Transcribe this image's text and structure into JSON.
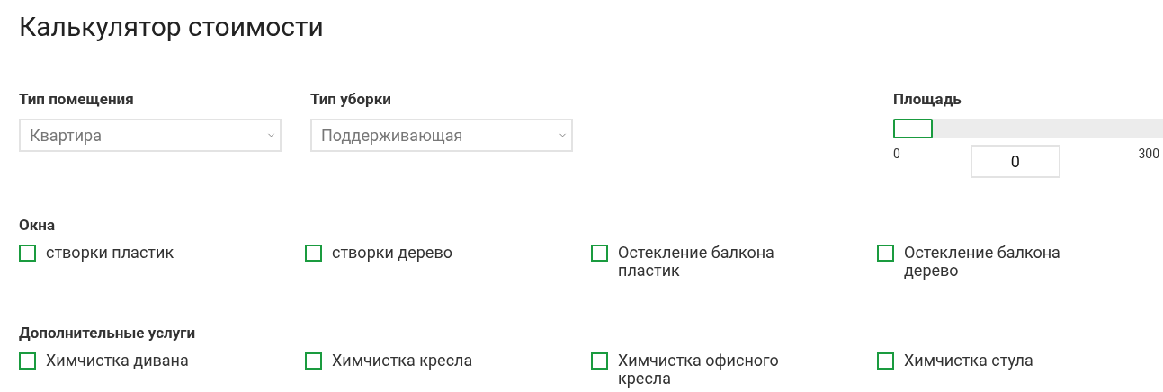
{
  "title": "Калькулятор стоимости",
  "selects": [
    {
      "label": "Тип помещения",
      "value": "Квартира"
    },
    {
      "label": "Тип уборки",
      "value": "Поддерживающая"
    }
  ],
  "area": {
    "label": "Площадь",
    "level": 0,
    "min": "0",
    "max": "300",
    "value": "0"
  },
  "groups": [
    {
      "title": "Окна",
      "options": [
        {
          "label": "створки пластик",
          "checked": false
        },
        {
          "label": "створки дерево",
          "checked": false
        },
        {
          "label": "Остекление балкона пластик",
          "checked": false
        },
        {
          "label": "Остекление балкона дерево",
          "checked": false
        }
      ]
    },
    {
      "title": "Дополнительные услуги",
      "options": [
        {
          "label": "Химчистка дивана",
          "checked": false
        },
        {
          "label": "Химчистка кресла",
          "checked": false
        },
        {
          "label": "Химчистка офисного кресла",
          "checked": false
        },
        {
          "label": "Химчистка стула",
          "checked": false
        }
      ]
    }
  ]
}
